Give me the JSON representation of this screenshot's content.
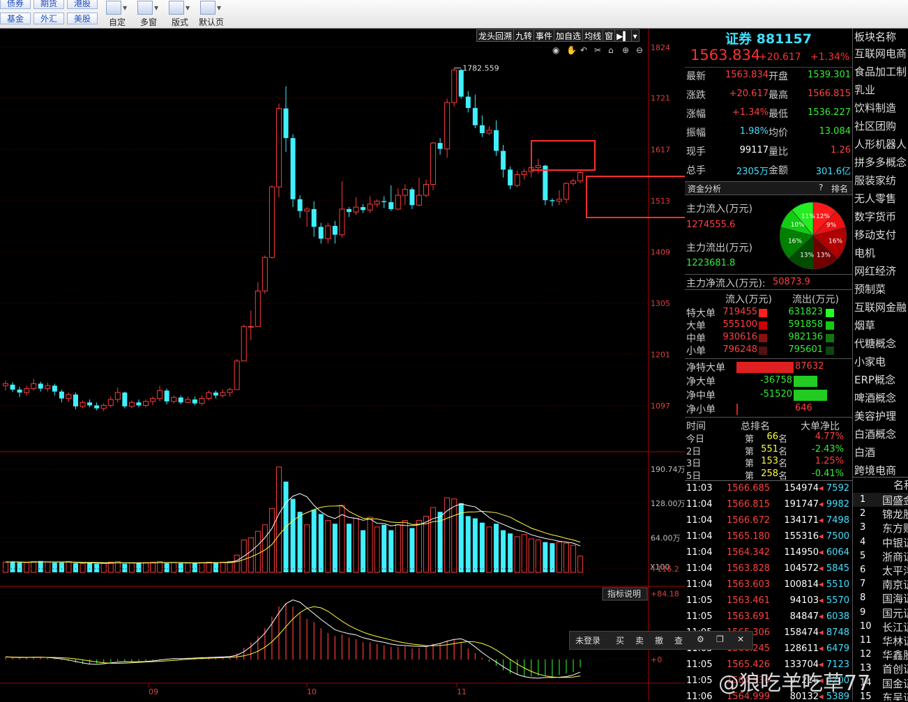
{
  "toolbar": {
    "markets": [
      "债券",
      "期货",
      "港股",
      "基金",
      "外汇",
      "美股"
    ],
    "tools": [
      "自定",
      "多窗",
      "版式",
      "默认页"
    ]
  },
  "chart": {
    "tabs": [
      "龙头回溯",
      "九转",
      "事件",
      "加自选",
      "均线",
      "窗"
    ],
    "price_scale": [
      "1824",
      "1721",
      "1617",
      "1513",
      "1409",
      "1305",
      "1201",
      "1097"
    ],
    "high_label": "1782.559",
    "vol_scale": [
      "190.74万",
      "128.00万",
      "64.00万"
    ],
    "vol_unit": "X100",
    "macd_button": "指标说明",
    "macd_scale": [
      "+116.2",
      "+84.18",
      "+0"
    ],
    "months": [
      "09",
      "10",
      "11"
    ]
  },
  "chart_data": {
    "type": "candlestick",
    "ylim": [
      1045,
      1845
    ],
    "candles": [
      [
        1138,
        1142,
        1128,
        1148
      ],
      [
        1140,
        1130,
        1125,
        1145
      ],
      [
        1130,
        1124,
        1115,
        1136
      ],
      [
        1124,
        1132,
        1118,
        1138
      ],
      [
        1132,
        1142,
        1128,
        1152
      ],
      [
        1142,
        1132,
        1126,
        1146
      ],
      [
        1132,
        1138,
        1126,
        1144
      ],
      [
        1138,
        1126,
        1118,
        1142
      ],
      [
        1126,
        1112,
        1104,
        1130
      ],
      [
        1112,
        1120,
        1106,
        1124
      ],
      [
        1120,
        1096,
        1090,
        1124
      ],
      [
        1096,
        1104,
        1092,
        1108
      ],
      [
        1104,
        1098,
        1094,
        1110
      ],
      [
        1098,
        1092,
        1088,
        1104
      ],
      [
        1092,
        1098,
        1086,
        1102
      ],
      [
        1098,
        1110,
        1094,
        1116
      ],
      [
        1110,
        1124,
        1104,
        1134
      ],
      [
        1124,
        1096,
        1092,
        1126
      ],
      [
        1096,
        1104,
        1092,
        1108
      ],
      [
        1104,
        1098,
        1094,
        1110
      ],
      [
        1098,
        1106,
        1094,
        1110
      ],
      [
        1106,
        1112,
        1098,
        1116
      ],
      [
        1112,
        1128,
        1106,
        1138
      ],
      [
        1128,
        1106,
        1100,
        1132
      ],
      [
        1106,
        1114,
        1102,
        1118
      ],
      [
        1114,
        1104,
        1100,
        1118
      ],
      [
        1104,
        1110,
        1102,
        1116
      ],
      [
        1110,
        1102,
        1098,
        1116
      ],
      [
        1102,
        1112,
        1098,
        1118
      ],
      [
        1112,
        1124,
        1108,
        1128
      ],
      [
        1124,
        1118,
        1112,
        1128
      ],
      [
        1118,
        1124,
        1114,
        1130
      ],
      [
        1124,
        1130,
        1116,
        1134
      ],
      [
        1130,
        1188,
        1130,
        1192
      ],
      [
        1188,
        1258,
        1188,
        1262
      ],
      [
        1258,
        1258,
        1230,
        1290
      ],
      [
        1258,
        1330,
        1258,
        1348
      ],
      [
        1330,
        1398,
        1324,
        1402
      ],
      [
        1398,
        1541,
        1396,
        1544
      ],
      [
        1541,
        1700,
        1520,
        1710
      ],
      [
        1700,
        1640,
        1612,
        1745
      ],
      [
        1640,
        1516,
        1500,
        1648
      ],
      [
        1516,
        1492,
        1478,
        1524
      ],
      [
        1492,
        1496,
        1460,
        1500
      ],
      [
        1496,
        1460,
        1440,
        1512
      ],
      [
        1460,
        1436,
        1426,
        1468
      ],
      [
        1436,
        1462,
        1426,
        1468
      ],
      [
        1462,
        1444,
        1426,
        1472
      ],
      [
        1444,
        1496,
        1438,
        1552
      ],
      [
        1496,
        1490,
        1480,
        1500
      ],
      [
        1490,
        1500,
        1484,
        1520
      ],
      [
        1500,
        1494,
        1488,
        1506
      ],
      [
        1494,
        1506,
        1488,
        1522
      ],
      [
        1506,
        1512,
        1500,
        1516
      ],
      [
        1512,
        1510,
        1498,
        1522
      ],
      [
        1510,
        1496,
        1492,
        1544
      ],
      [
        1496,
        1524,
        1494,
        1538
      ],
      [
        1524,
        1536,
        1504,
        1546
      ],
      [
        1536,
        1504,
        1496,
        1540
      ],
      [
        1504,
        1524,
        1502,
        1560
      ],
      [
        1524,
        1546,
        1520,
        1556
      ],
      [
        1546,
        1630,
        1534,
        1632
      ],
      [
        1630,
        1618,
        1606,
        1640
      ],
      [
        1618,
        1712,
        1600,
        1720
      ],
      [
        1712,
        1778,
        1704,
        1782
      ],
      [
        1778,
        1724,
        1720,
        1780
      ],
      [
        1724,
        1701,
        1692,
        1735
      ],
      [
        1701,
        1666,
        1660,
        1728
      ],
      [
        1666,
        1650,
        1642,
        1686
      ],
      [
        1650,
        1656,
        1646,
        1664
      ],
      [
        1656,
        1614,
        1604,
        1676
      ],
      [
        1614,
        1576,
        1560,
        1626
      ],
      [
        1576,
        1544,
        1536,
        1582
      ],
      [
        1544,
        1566,
        1540,
        1574
      ],
      [
        1566,
        1572,
        1556,
        1578
      ],
      [
        1572,
        1580,
        1560,
        1588
      ],
      [
        1580,
        1584,
        1568,
        1598
      ],
      [
        1584,
        1514,
        1504,
        1586
      ],
      [
        1514,
        1512,
        1502,
        1518
      ],
      [
        1512,
        1516,
        1504,
        1534
      ],
      [
        1516,
        1548,
        1508,
        1550
      ],
      [
        1548,
        1553,
        1543,
        1558
      ],
      [
        1553,
        1570,
        1548,
        1574
      ]
    ],
    "volumes": [
      19,
      20,
      18,
      18,
      20,
      21,
      19,
      18,
      18,
      20,
      17,
      16,
      17,
      16,
      17,
      19,
      20,
      16,
      17,
      17,
      18,
      19,
      20,
      17,
      18,
      17,
      17,
      17,
      18,
      19,
      18,
      19,
      20,
      32,
      60,
      64,
      76,
      88,
      118,
      195,
      168,
      136,
      112,
      88,
      116,
      108,
      96,
      90,
      124,
      90,
      100,
      78,
      102,
      84,
      88,
      78,
      88,
      96,
      82,
      96,
      104,
      120,
      112,
      138,
      136,
      128,
      104,
      100,
      92,
      84,
      90,
      78,
      72,
      66,
      70,
      62,
      60,
      56,
      54,
      56,
      54,
      50,
      30
    ],
    "macd_hist": [
      3,
      2,
      2,
      3,
      3,
      2,
      2,
      1,
      -1,
      -2,
      -4,
      -6,
      -6,
      -5,
      -4,
      -3,
      -2,
      -3,
      -3,
      -2,
      -2,
      -1,
      1,
      1,
      1,
      1,
      2,
      2,
      2,
      3,
      3,
      3,
      4,
      8,
      15,
      22,
      30,
      40,
      55,
      68,
      72,
      68,
      60,
      52,
      48,
      40,
      34,
      30,
      32,
      28,
      26,
      22,
      22,
      20,
      18,
      16,
      16,
      17,
      14,
      15,
      16,
      20,
      20,
      24,
      26,
      22,
      14,
      8,
      2,
      -3,
      -8,
      -14,
      -18,
      -20,
      -22,
      -22,
      -21,
      -20,
      -22,
      -20,
      -18,
      -16,
      -10
    ]
  },
  "quote": {
    "title": "证券 881157",
    "price": "1563.834",
    "change": "+20.617",
    "change_pct": "+1.34%",
    "rows": [
      {
        "k1": "最新",
        "v1": "1563.834",
        "k2": "开盘",
        "v2": "1539.301",
        "c1": "red",
        "c2": "grn"
      },
      {
        "k1": "涨跌",
        "v1": "+20.617",
        "k2": "最高",
        "v2": "1566.815",
        "c1": "red",
        "c2": "red"
      },
      {
        "k1": "涨幅",
        "v1": "+1.34%",
        "k2": "最低",
        "v2": "1536.227",
        "c1": "red",
        "c2": "grn"
      },
      {
        "k1": "振幅",
        "v1": "1.98%",
        "k2": "均价",
        "v2": "13.084",
        "c1": "cyan",
        "c2": "grn"
      },
      {
        "k1": "现手",
        "v1": "99117",
        "k2": "量比",
        "v2": "1.26",
        "c1": "wht",
        "c2": "red"
      },
      {
        "k1": "总手",
        "v1": "2305万",
        "k2": "金额",
        "v2": "301.6亿",
        "c1": "cyan",
        "c2": "cyan"
      }
    ]
  },
  "fund": {
    "title": "资金分析",
    "q": "?",
    "rank": "排名",
    "inflow_label": "主力流入(万元)",
    "inflow_value": "1274555.6",
    "outflow_label": "主力流出(万元)",
    "outflow_value": "1223681.8",
    "net_label": "主力净流入(万元):",
    "net_value": "50873.9",
    "pie": [
      {
        "label": "12%",
        "color": "#ff1a1a",
        "v": 12
      },
      {
        "label": "9%",
        "color": "#ee1111",
        "v": 9
      },
      {
        "label": "16%",
        "color": "#b00000",
        "v": 16
      },
      {
        "label": "13%",
        "color": "#700000",
        "v": 13
      },
      {
        "label": "13%",
        "color": "#004d00",
        "v": 13
      },
      {
        "label": "16%",
        "color": "#008000",
        "v": 16
      },
      {
        "label": "10%",
        "color": "#11cc11",
        "v": 10
      },
      {
        "label": "11%",
        "color": "#22ee22",
        "v": 11
      }
    ],
    "col_in": "流入(万元)",
    "col_out": "流出(万元)",
    "orders": [
      {
        "name": "特大单",
        "in": "719455",
        "out": "631823",
        "ic": "#ff2020",
        "oc": "#22ff22"
      },
      {
        "name": "大单",
        "in": "555100",
        "out": "591858",
        "ic": "#cc0000",
        "oc": "#11cc11"
      },
      {
        "name": "中单",
        "in": "930616",
        "out": "982136",
        "ic": "#881111",
        "oc": "#117711"
      },
      {
        "name": "小单",
        "in": "796248",
        "out": "795601",
        "ic": "#551111",
        "oc": "#114411"
      }
    ],
    "net": [
      {
        "name": "净特大单",
        "value": "87632",
        "w": 82,
        "color": "#e02020",
        "side": "right"
      },
      {
        "name": "净大单",
        "value": "-36758",
        "w": 34,
        "color": "#22cc22",
        "side": "left"
      },
      {
        "name": "净中单",
        "value": "-51520",
        "w": 48,
        "color": "#22cc22",
        "side": "left"
      },
      {
        "name": "净小单",
        "value": "646",
        "w": 2,
        "color": "#e02020",
        "side": "right"
      }
    ],
    "rank_head": [
      "时间",
      "总排名",
      "大单净比"
    ],
    "ranks": [
      {
        "t": "今日",
        "d": "第",
        "n": "66",
        "u": "名",
        "p": "4.77%",
        "c": "red"
      },
      {
        "t": "2日",
        "d": "第",
        "n": "551",
        "u": "名",
        "p": "-2.43%",
        "c": "grn"
      },
      {
        "t": "3日",
        "d": "第",
        "n": "153",
        "u": "名",
        "p": "1.25%",
        "c": "red"
      },
      {
        "t": "5日",
        "d": "第",
        "n": "258",
        "u": "名",
        "p": "-0.41%",
        "c": "grn"
      }
    ]
  },
  "ticks": [
    {
      "t": "11:03",
      "p": "1566.685",
      "a": "154974",
      "v": "7592"
    },
    {
      "t": "11:04",
      "p": "1566.815",
      "a": "191747",
      "v": "9982"
    },
    {
      "t": "11:04",
      "p": "1566.672",
      "a": "134171",
      "v": "7498"
    },
    {
      "t": "11:04",
      "p": "1565.180",
      "a": "155316",
      "v": "7500"
    },
    {
      "t": "11:04",
      "p": "1564.342",
      "a": "114950",
      "v": "6064"
    },
    {
      "t": "11:04",
      "p": "1563.828",
      "a": "104572",
      "v": "5845"
    },
    {
      "t": "11:04",
      "p": "1563.603",
      "a": "100814",
      "v": "5510"
    },
    {
      "t": "11:05",
      "p": "1563.461",
      "a": "94103",
      "v": "5570"
    },
    {
      "t": "11:05",
      "p": "1563.691",
      "a": "84847",
      "v": "6038"
    },
    {
      "t": "11:05",
      "p": "1565.306",
      "a": "158474",
      "v": "8748"
    },
    {
      "t": "11:05",
      "p": "1566.245",
      "a": "128611",
      "v": "6479"
    },
    {
      "t": "11:05",
      "p": "1565.426",
      "a": "133704",
      "v": "7123"
    },
    {
      "t": "11:05",
      "p": "1564.930",
      "a": "97216",
      "v": "5200"
    },
    {
      "t": "11:06",
      "p": "1564.999",
      "a": "80132",
      "v": "5389"
    }
  ],
  "sectors": {
    "header": "板块名称",
    "items": [
      "互联网电商",
      "食品加工制",
      "乳业",
      "饮料制造",
      "社区团购",
      "人形机器人",
      "拼多多概念",
      "服装家纺",
      "无人零售",
      "数字货币",
      "移动支付",
      "电机",
      "网红经济",
      "预制菜",
      "互联网金融",
      "烟草",
      "代糖概念",
      "小家电",
      "ERP概念",
      "啤酒概念",
      "美容护理",
      "白酒概念",
      "白酒",
      "跨境电商"
    ]
  },
  "stocks": {
    "header": "名称",
    "items": [
      {
        "n": "1",
        "name": "国盛金"
      },
      {
        "n": "2",
        "name": "锦龙股"
      },
      {
        "n": "3",
        "name": "东方财"
      },
      {
        "n": "4",
        "name": "中银证"
      },
      {
        "n": "5",
        "name": "浙商证"
      },
      {
        "n": "6",
        "name": "太平洋"
      },
      {
        "n": "7",
        "name": "南京证"
      },
      {
        "n": "8",
        "name": "国海证"
      },
      {
        "n": "9",
        "name": "国元证"
      },
      {
        "n": "10",
        "name": "长江证"
      },
      {
        "n": "11",
        "name": "华林证"
      },
      {
        "n": "12",
        "name": "华鑫股"
      },
      {
        "n": "13",
        "name": "首创证"
      },
      {
        "n": "14",
        "name": "国金证"
      },
      {
        "n": "15",
        "name": "东吴证"
      }
    ]
  },
  "popup": [
    "未登录",
    "买",
    "卖",
    "撤",
    "查"
  ],
  "watermark": "@狼吃羊吃草77"
}
